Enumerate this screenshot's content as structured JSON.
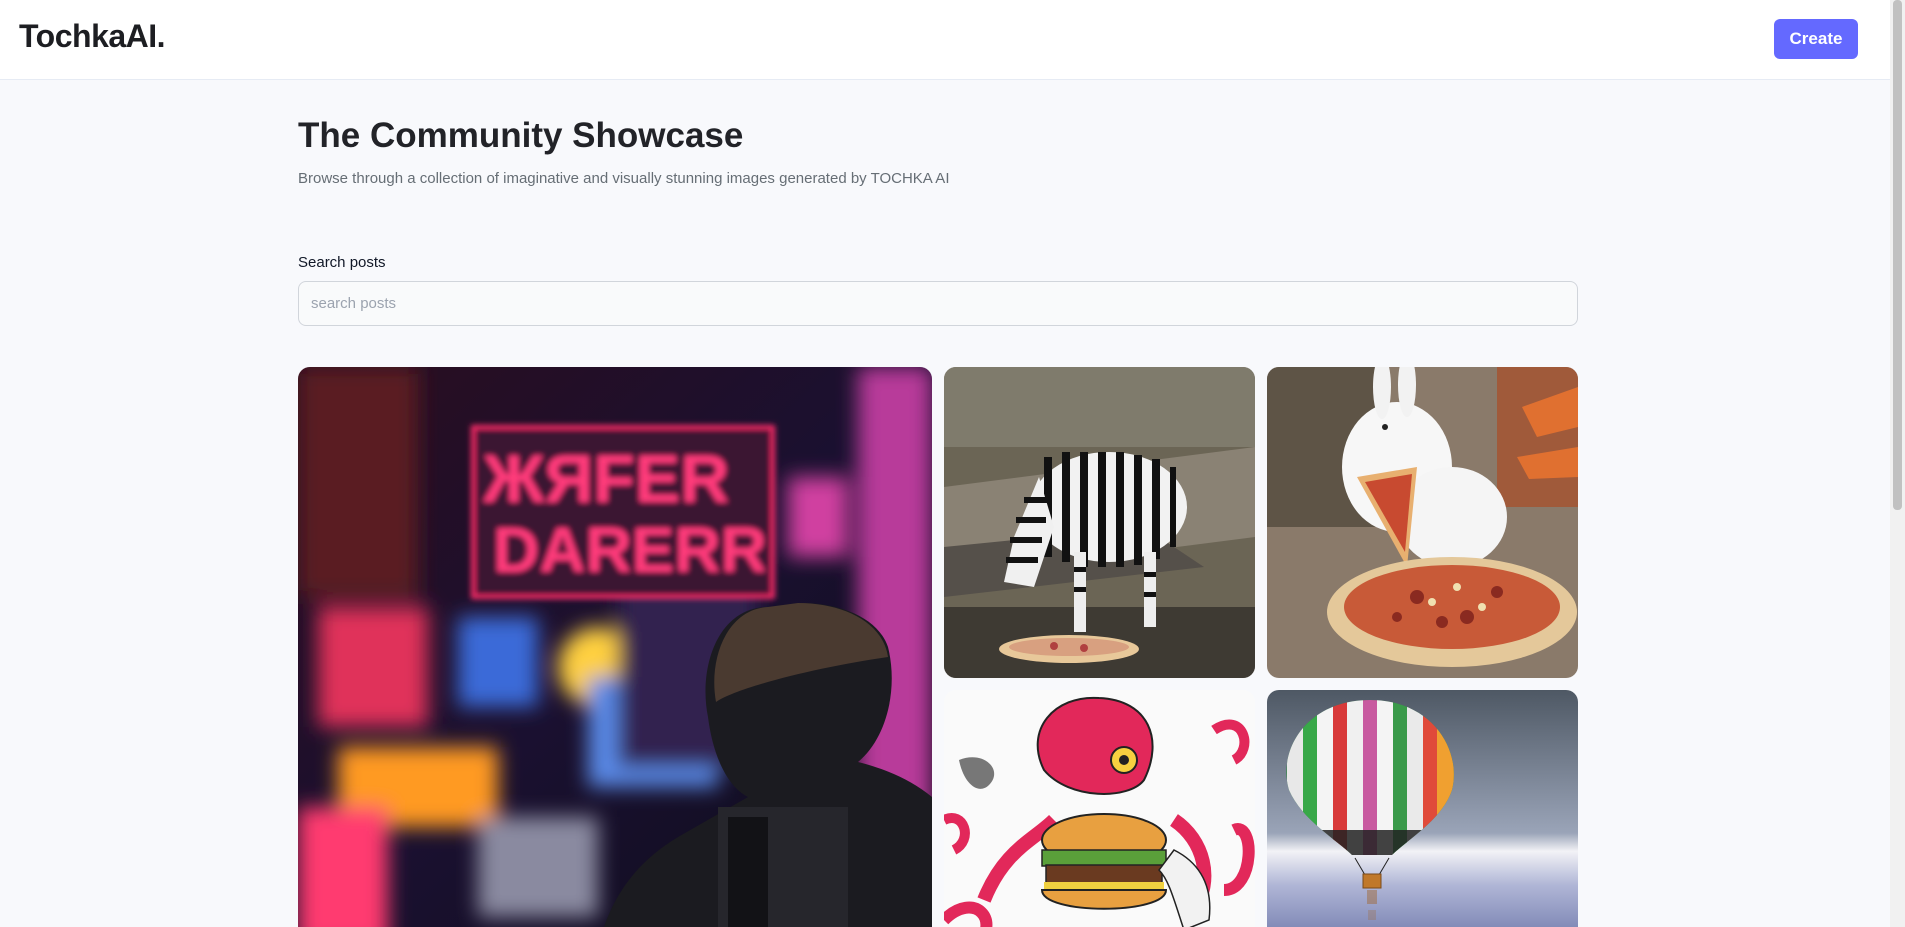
{
  "header": {
    "logo": "TochkaAI.",
    "create_label": "Create"
  },
  "hero": {
    "title": "The Community Showcase",
    "subtitle": "Browse through a collection of imaginative and visually stunning images generated by TOCHKA AI"
  },
  "search": {
    "label": "Search posts",
    "placeholder": "search posts",
    "value": ""
  },
  "gallery": {
    "cards": [
      {
        "name": "neon-city-person-image"
      },
      {
        "name": "zebra-eating-pizza-image"
      },
      {
        "name": "rabbit-eating-pizza-image"
      },
      {
        "name": "octopus-burger-image"
      },
      {
        "name": "hot-air-balloon-image"
      }
    ]
  },
  "colors": {
    "accent": "#6469ff",
    "background": "#f8f9fc",
    "title": "#222328",
    "subtitle": "#666e75"
  }
}
